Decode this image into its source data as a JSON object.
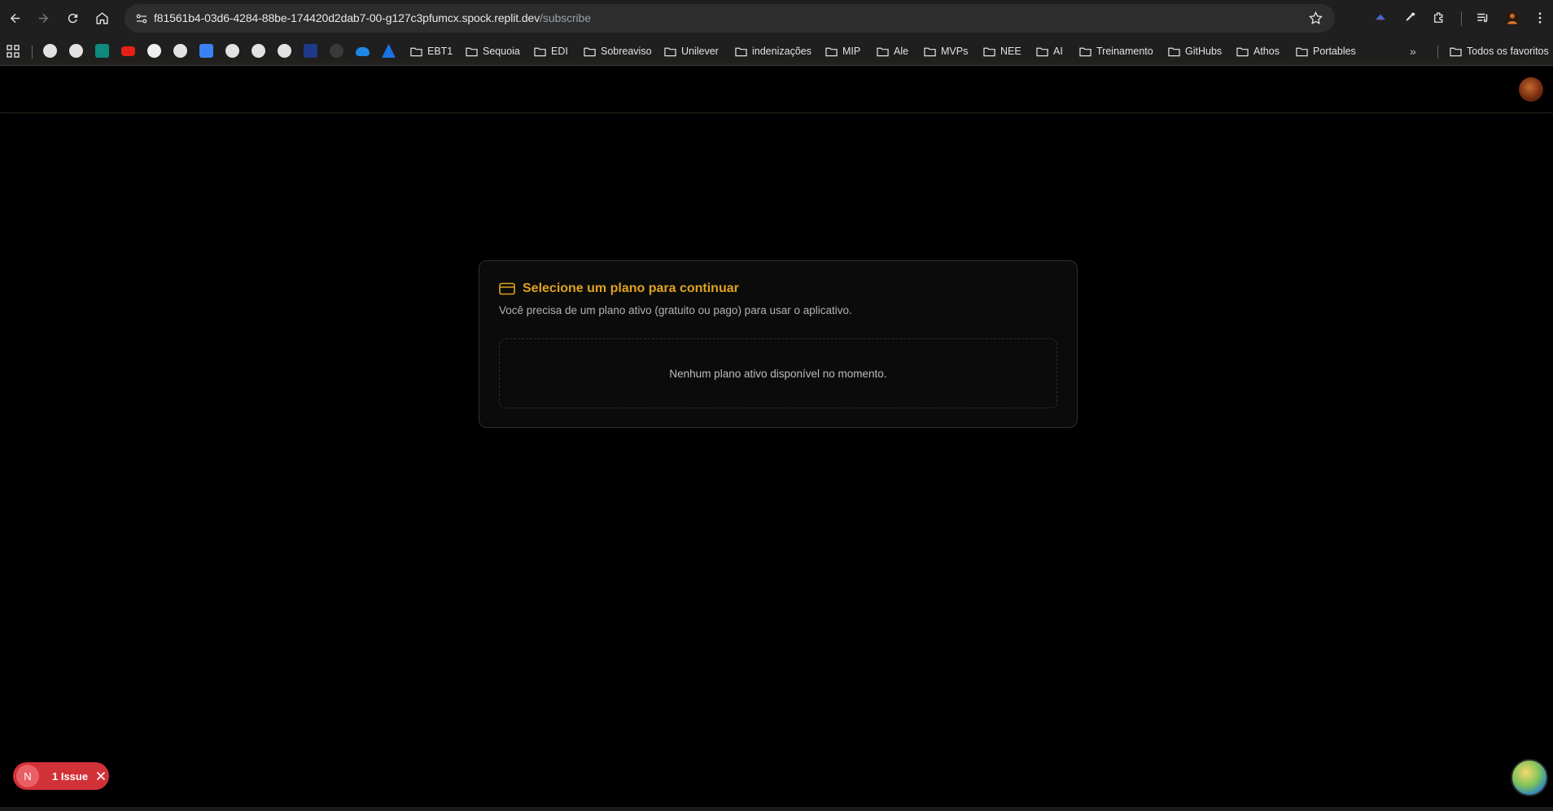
{
  "browser": {
    "url_host": "f81561b4-03d6-4284-88be-174420d2dab7-00-g127c3pfumcx.spock.replit.dev",
    "url_path": "/subscribe",
    "bookmark_folders": [
      "EBT1",
      "Sequoia",
      "EDI",
      "Sobreaviso",
      "Unilever",
      "indenizações",
      "MIP",
      "Ale",
      "MVPs",
      "NEE",
      "AI",
      "Treinamento",
      "GitHubs",
      "Athos",
      "Portables"
    ],
    "all_bookmarks_label": "Todos os favoritos",
    "more_label": "»"
  },
  "card": {
    "title": "Selecione um plano para continuar",
    "subtitle": "Você precisa de um plano ativo (gratuito ou pago) para usar o aplicativo.",
    "empty_message": "Nenhum plano ativo disponível no momento."
  },
  "issues": {
    "badge": "N",
    "label": "1 Issue"
  },
  "colors": {
    "accent": "#e0a21f",
    "issue_red": "#d23138"
  }
}
